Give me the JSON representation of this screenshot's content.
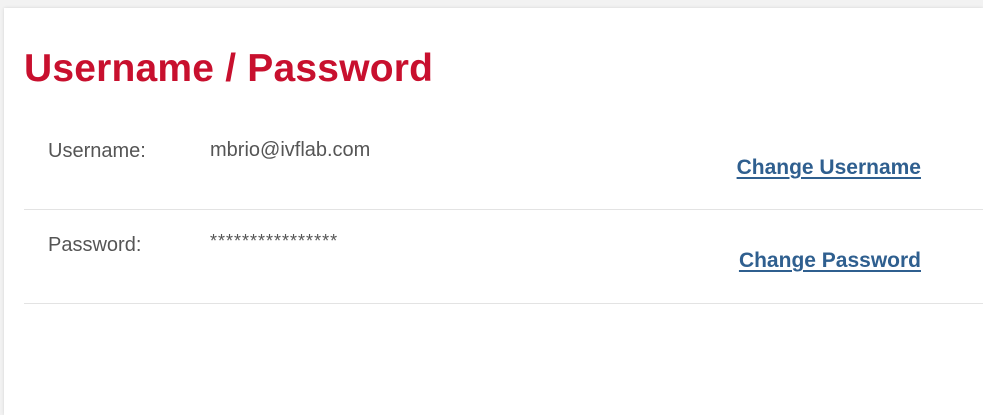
{
  "section": {
    "title": "Username / Password"
  },
  "username": {
    "label": "Username:",
    "value": "mbrio@ivflab.com",
    "action_label": "Change Username"
  },
  "password": {
    "label": "Password:",
    "value": "****************",
    "action_label": "Change Password"
  },
  "colors": {
    "title": "#c8102e",
    "link": "#2f5f8f",
    "text": "#555555",
    "divider": "#e3e3e3"
  }
}
